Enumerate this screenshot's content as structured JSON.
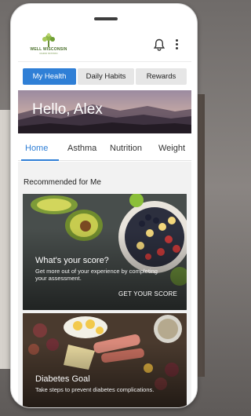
{
  "logo": {
    "name": "WELL WISCONSIN",
    "tagline": "RADIO STATION"
  },
  "segments": [
    {
      "label": "My Health",
      "active": true
    },
    {
      "label": "Daily Habits",
      "active": false
    },
    {
      "label": "Rewards",
      "active": false
    }
  ],
  "hero": {
    "greeting": "Hello, Alex"
  },
  "tabs": [
    {
      "label": "Home",
      "active": true
    },
    {
      "label": "Asthma",
      "active": false
    },
    {
      "label": "Nutrition",
      "active": false
    },
    {
      "label": "Weight",
      "active": false
    }
  ],
  "recommended": {
    "title": "Recommended for Me",
    "cards": [
      {
        "title": "What's your score?",
        "description": "Get more out of your experience by completing your assessment.",
        "cta": "GET YOUR SCORE"
      },
      {
        "title": "Diabetes Goal",
        "description": "Take steps to prevent diabetes complications."
      }
    ]
  },
  "colors": {
    "accent": "#2f7fd6",
    "logo_green": "#4a6f2a"
  },
  "icons": {
    "notifications": "bell-icon",
    "menu": "more-vertical-icon"
  }
}
